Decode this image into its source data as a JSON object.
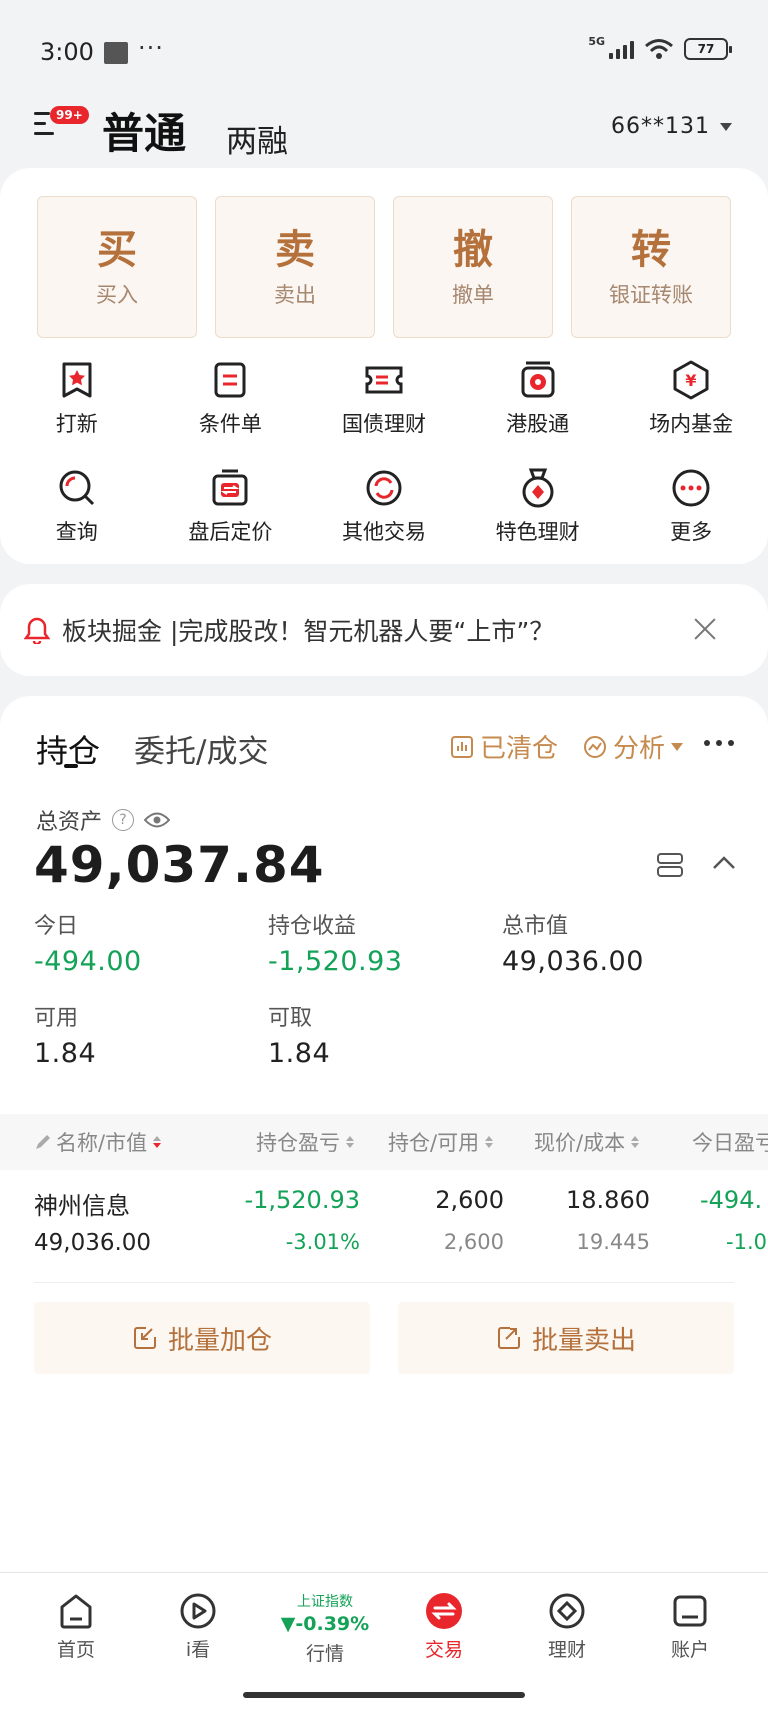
{
  "status_bar": {
    "time": "3:00",
    "dots": "···",
    "network": "5G",
    "battery": "77"
  },
  "header": {
    "badge": "99+",
    "tab_normal": "普通",
    "tab_margin": "两融",
    "account": "66**131"
  },
  "quick_actions": [
    {
      "char": "买",
      "label": "买入"
    },
    {
      "char": "卖",
      "label": "卖出"
    },
    {
      "char": "撤",
      "label": "撤单"
    },
    {
      "char": "转",
      "label": "银证转账"
    }
  ],
  "grid_menu": [
    {
      "label": "打新",
      "icon": "ipo-icon"
    },
    {
      "label": "条件单",
      "icon": "conditional-order-icon"
    },
    {
      "label": "国债理财",
      "icon": "treasury-icon"
    },
    {
      "label": "港股通",
      "icon": "hk-connect-icon"
    },
    {
      "label": "场内基金",
      "icon": "fund-icon"
    },
    {
      "label": "查询",
      "icon": "query-icon"
    },
    {
      "label": "盘后定价",
      "icon": "after-hours-icon"
    },
    {
      "label": "其他交易",
      "icon": "other-trade-icon"
    },
    {
      "label": "特色理财",
      "icon": "featured-finance-icon"
    },
    {
      "label": "更多",
      "icon": "more-icon"
    }
  ],
  "notice": {
    "text": "板块掘金 |完成股改！智元机器人要“上市”？"
  },
  "holdings": {
    "tab_holdings": "持仓",
    "tab_orders": "委托/成交",
    "cleared": "已清仓",
    "analysis": "分析",
    "total_assets_label": "总资产",
    "total_assets_value": "49,037.84",
    "stats": {
      "today_label": "今日",
      "today_value": "-494.00",
      "pnl_label": "持仓收益",
      "pnl_value": "-1,520.93",
      "mv_label": "总市值",
      "mv_value": "49,036.00",
      "avail_label": "可用",
      "avail_value": "1.84",
      "withdraw_label": "可取",
      "withdraw_value": "1.84"
    },
    "columns": [
      "名称/市值",
      "持仓盈亏",
      "持仓/可用",
      "现价/成本",
      "今日盈亏"
    ],
    "rows": [
      {
        "name": "神州信息",
        "market_value": "49,036.00",
        "pnl": "-1,520.93",
        "pnl_pct": "-3.01%",
        "position": "2,600",
        "available": "2,600",
        "price": "18.860",
        "cost": "19.445",
        "today_pnl": "-494.",
        "today_pct": "-1.0"
      }
    ],
    "batch_add": "批量加仓",
    "batch_sell": "批量卖出"
  },
  "bottom_nav": {
    "home": "首页",
    "watch": "i看",
    "market_index_name": "上证指数",
    "market_index_change": "▼-0.39%",
    "market": "行情",
    "trade": "交易",
    "finance": "理财",
    "account": "账户"
  },
  "colors": {
    "accent": "#e8262c",
    "gold": "#b4713c",
    "down_green": "#13a257"
  }
}
